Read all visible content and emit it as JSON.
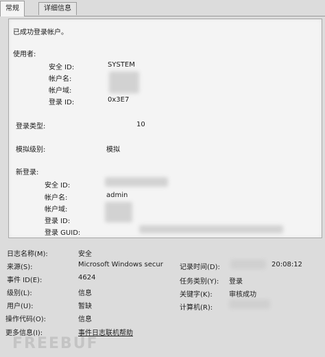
{
  "tabs": [
    {
      "label": "常规",
      "active": true
    },
    {
      "label": "详细信息",
      "active": false
    }
  ],
  "message": {
    "intro": "已成功登录帐户。",
    "subject": {
      "heading": "使用者:",
      "security_id_label": "安全 ID:",
      "security_id_value": "SYSTEM",
      "account_name_label": "帐户名:",
      "account_domain_label": "帐户域:",
      "logon_id_label": "登录 ID:",
      "logon_id_value": "0x3E7"
    },
    "logon_type_label": "登录类型:",
    "logon_type_value": "10",
    "impersonation_label": "模拟级别:",
    "impersonation_value": "模拟",
    "new_logon": {
      "heading": "新登录:",
      "security_id_label": "安全 ID:",
      "account_name_label": "帐户名:",
      "account_name_value": "admin",
      "account_domain_label": "帐户域:",
      "logon_id_label": "登录 ID:",
      "logon_guid_label": "登录 GUID:"
    }
  },
  "properties": {
    "log_name_label": "日志名称(M):",
    "log_name_value": "安全",
    "source_label": "来源(S):",
    "source_value": "Microsoft Windows secur",
    "logged_label": "记录时间(D):",
    "logged_value": "20:08:12",
    "event_id_label": "事件 ID(E):",
    "event_id_value": "4624",
    "task_category_label": "任务类别(Y):",
    "task_category_value": "登录",
    "level_label": "级别(L):",
    "level_value": "信息",
    "keywords_label": "关键字(K):",
    "keywords_value": "审核成功",
    "user_label": "用户(U):",
    "user_value": "暂缺",
    "computer_label": "计算机(R):",
    "opcode_label": "操作代码(O):",
    "opcode_value": "信息",
    "more_info_label": "更多信息(I):",
    "more_info_link": "事件日志联机帮助"
  },
  "watermark": "FREEBUF"
}
